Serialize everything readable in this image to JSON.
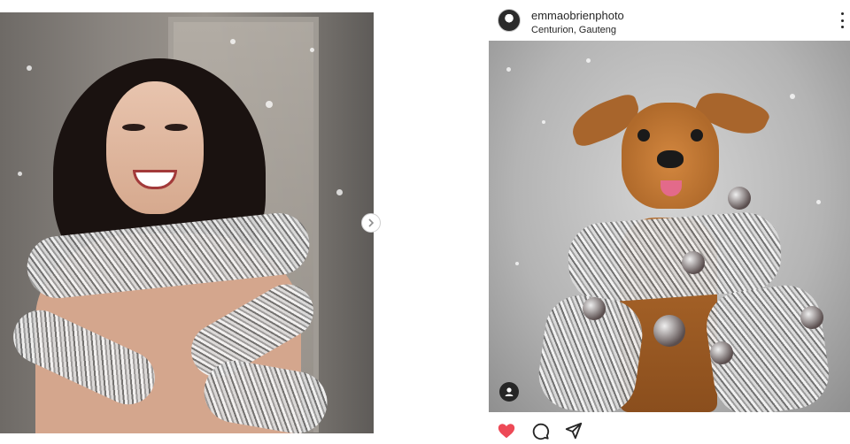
{
  "left_post": {
    "carousel_next": "next-slide"
  },
  "right_post": {
    "username": "emmaobrienphoto",
    "location": "Centurion, Gauteng",
    "actions": {
      "like_liked": true,
      "like_color": "#ed4956"
    }
  },
  "icons": [
    "chevron-right-icon",
    "more-options-icon",
    "user-tag-icon",
    "heart-icon",
    "comment-icon",
    "share-icon"
  ]
}
